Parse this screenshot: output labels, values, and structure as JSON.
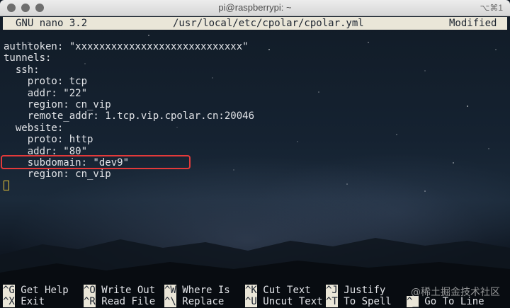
{
  "window": {
    "title": "pi@raspberrypi: ~",
    "shortcut_hint": "⌥⌘1"
  },
  "header": {
    "app": "GNU nano 3.2",
    "file": "/usr/local/etc/cpolar/cpolar.yml",
    "status": "Modified"
  },
  "editor": {
    "lines": [
      "authtoken: \"xxxxxxxxxxxxxxxxxxxxxxxxxxxx\"",
      "tunnels:",
      "  ssh:",
      "    proto: tcp",
      "    addr: \"22\"",
      "    region: cn_vip",
      "    remote_addr: 1.tcp.vip.cpolar.cn:20046",
      "  website:",
      "    proto: http",
      "    addr: \"80\"",
      "    subdomain: \"dev9\"",
      "    region: cn_vip"
    ]
  },
  "shortcuts": {
    "row1": [
      {
        "key": "^G",
        "label": "Get Help"
      },
      {
        "key": "^O",
        "label": "Write Out"
      },
      {
        "key": "^W",
        "label": "Where Is"
      },
      {
        "key": "^K",
        "label": "Cut Text"
      },
      {
        "key": "^J",
        "label": "Justify"
      }
    ],
    "row2": [
      {
        "key": "^X",
        "label": "Exit"
      },
      {
        "key": "^R",
        "label": "Read File"
      },
      {
        "key": "^\\",
        "label": "Replace"
      },
      {
        "key": "^U",
        "label": "Uncut Text"
      },
      {
        "key": "^T",
        "label": "To Spell"
      },
      {
        "key": "^_",
        "label": "Go To Line"
      }
    ]
  },
  "watermark": "@稀土掘金技术社区",
  "colors": {
    "highlight_box": "#e23a3a",
    "header_bg": "#eae6d8",
    "cursor": "#e8c43a"
  }
}
